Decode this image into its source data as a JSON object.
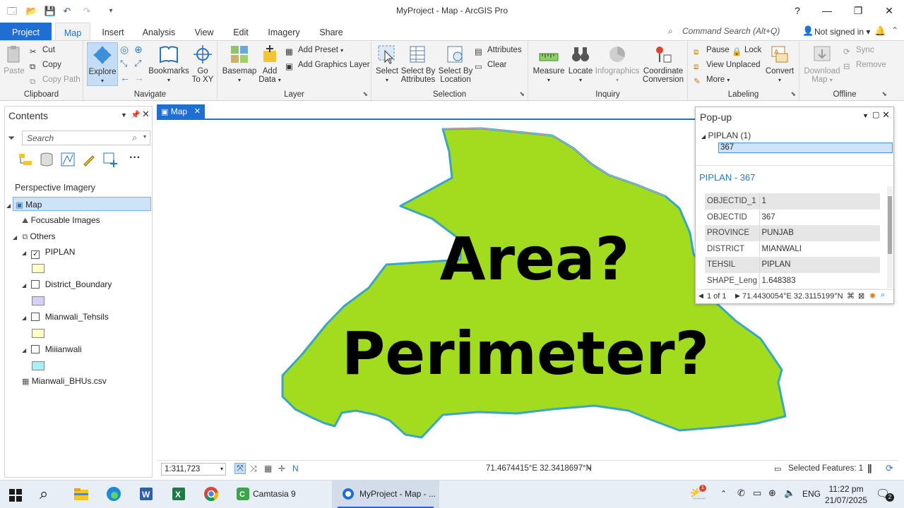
{
  "window": {
    "title": "MyProject - Map - ArcGIS Pro",
    "help": "?",
    "minimize": "—",
    "maximize": "❐",
    "close": "✕"
  },
  "quick_access": [
    "new-icon",
    "open-icon",
    "save-icon",
    "undo-icon",
    "redo-icon",
    "customize-icon"
  ],
  "ribbon_tabs": [
    {
      "label": "Project"
    },
    {
      "label": "Map"
    },
    {
      "label": "Insert"
    },
    {
      "label": "Analysis"
    },
    {
      "label": "View"
    },
    {
      "label": "Edit"
    },
    {
      "label": "Imagery"
    },
    {
      "label": "Share"
    }
  ],
  "command_search": {
    "placeholder": "Command Search (Alt+Q)"
  },
  "sign_in": {
    "label": "Not signed in"
  },
  "ribbon": {
    "clipboard": {
      "label": "Clipboard",
      "paste": "Paste",
      "cut": "Cut",
      "copy": "Copy",
      "copy_path": "Copy Path"
    },
    "navigate": {
      "label": "Navigate",
      "explore": "Explore",
      "bookmarks": "Bookmarks",
      "go_to_xy_1": "Go",
      "go_to_xy_2": "To XY"
    },
    "layer": {
      "label": "Layer",
      "basemap": "Basemap",
      "add_data_1": "Add",
      "add_data_2": "Data",
      "add_preset": "Add Preset",
      "add_graphics_layer": "Add Graphics Layer"
    },
    "selection": {
      "label": "Selection",
      "select": "Select",
      "select_by_attributes_1": "Select By",
      "select_by_attributes_2": "Attributes",
      "select_by_location_1": "Select By",
      "select_by_location_2": "Location",
      "attributes": "Attributes",
      "clear": "Clear"
    },
    "inquiry": {
      "label": "Inquiry",
      "measure": "Measure",
      "locate": "Locate",
      "infographics": "Infographics",
      "coordinate_conversion_1": "Coordinate",
      "coordinate_conversion_2": "Conversion"
    },
    "labeling": {
      "label": "Labeling",
      "pause": "Pause",
      "lock": "Lock",
      "view_unplaced": "View Unplaced",
      "more": "More",
      "convert": "Convert"
    },
    "offline": {
      "label": "Offline",
      "download_map_1": "Download",
      "download_map_2": "Map",
      "sync": "Sync",
      "remove": "Remove"
    }
  },
  "contents": {
    "title": "Contents",
    "search_placeholder": "Search",
    "section": "Perspective Imagery",
    "tree": [
      {
        "label": "Map"
      },
      {
        "label": "Focusable Images"
      },
      {
        "label": "Others"
      },
      {
        "label": "PIPLAN",
        "checked": true,
        "color": "#ffffc8"
      },
      {
        "label": "District_Boundary",
        "checked": false,
        "color": "#d8d0fa"
      },
      {
        "label": "Mianwali_Tehsils",
        "checked": false,
        "color": "#ffffc8"
      },
      {
        "label": "Miiianwali",
        "checked": false,
        "color": "#a8f0f5"
      },
      {
        "label": "Mianwali_BHUs.csv"
      }
    ]
  },
  "map": {
    "tab_label": "Map",
    "tab_close": "✕",
    "overlay_line1": "Area?",
    "overlay_line2": "Perimeter?",
    "polygon_fill": "#a2dc1e",
    "polygon_outline": "#3aa6c0",
    "scale": "1:311,723",
    "coords": "71.4674415°E 32.3418697°N",
    "selected_features": "Selected Features: 1"
  },
  "popup": {
    "title": "Pop-up",
    "layer": "PIPLAN  (1)",
    "feature": "367",
    "header": "PIPLAN - 367",
    "rows": [
      {
        "key": "OBJECTID_1",
        "value": "1"
      },
      {
        "key": "OBJECTID",
        "value": "367"
      },
      {
        "key": "PROVINCE",
        "value": "PUNJAB"
      },
      {
        "key": "DISTRICT",
        "value": "MIANWALI"
      },
      {
        "key": "TEHSIL",
        "value": "PIPLAN"
      },
      {
        "key": "SHAPE_Leng",
        "value": "1.648383"
      }
    ],
    "pager": "1 of 1",
    "coords": "71.4430054°E 32.3115199°N"
  },
  "taskbar": {
    "apps": [
      "windows-start-icon",
      "search-icon",
      "file-explorer-icon",
      "edge-icon",
      "word-icon",
      "excel-icon",
      "chrome-icon"
    ],
    "camtasia": "Camtasia 9",
    "arcgis": "MyProject - Map - ...",
    "lang": "ENG",
    "time": "11:22 pm",
    "date": "21/07/2025",
    "notifications": "2"
  }
}
